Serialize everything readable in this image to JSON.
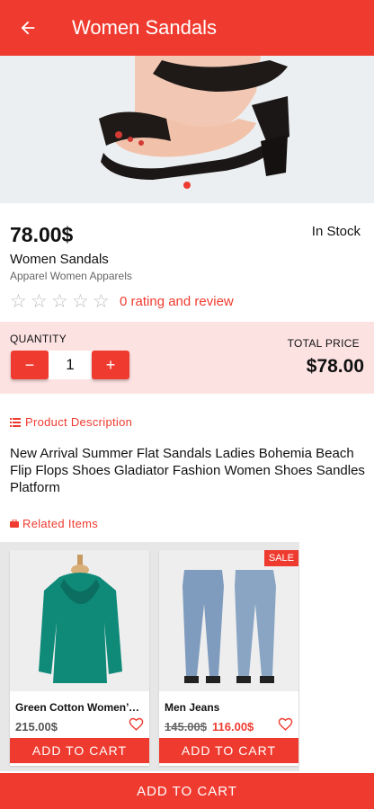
{
  "app_bar": {
    "title": "Women Sandals",
    "back_icon": "arrow-left-icon"
  },
  "product": {
    "price": "78.00$",
    "stock_status": "In Stock",
    "name": "Women Sandals",
    "category": "Apparel Women Apparels",
    "rating_stars": 0,
    "rating_max": 5,
    "rating_text": "0 rating and review",
    "image_slide_count": 1,
    "active_slide": 1
  },
  "quantity": {
    "label": "QUANTITY",
    "minus": "−",
    "value": "1",
    "plus": "+",
    "total_label": "TOTAL PRICE",
    "total_value": "$78.00"
  },
  "description": {
    "heading": "Product Description",
    "icon": "list-icon",
    "text": "New Arrival Summer Flat Sandals Ladies Bohemia Beach Flip Flops Shoes Gladiator Fashion Women Shoes Sandles Platform"
  },
  "related": {
    "heading": "Related Items",
    "icon": "bag-icon",
    "items": [
      {
        "name": "Green Cotton Women’s Top",
        "price": "215.00$",
        "old_price": "",
        "sale_badge": "",
        "button": "ADD TO CART"
      },
      {
        "name": "Men Jeans",
        "price": "116.00$",
        "old_price": "145.00$",
        "sale_badge": "SALE",
        "button": "ADD TO CART"
      }
    ]
  },
  "bottom_button": "ADD TO CART",
  "colors": {
    "accent": "#ef3b2f",
    "qty_bg": "#fde2e2"
  }
}
